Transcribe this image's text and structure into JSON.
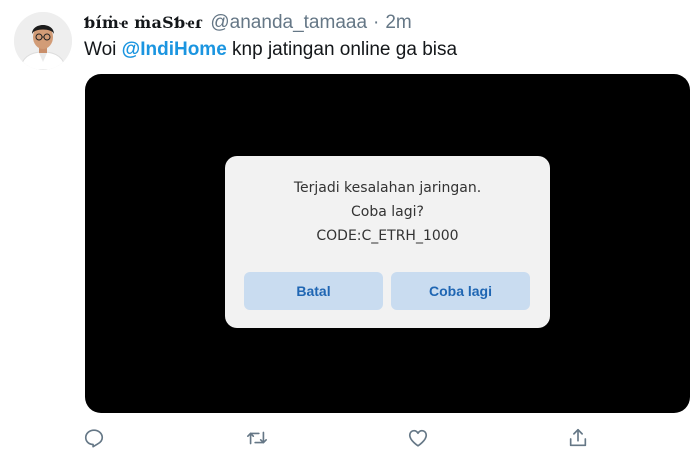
{
  "tweet": {
    "display_name": "ƅíṁҽ ṁaSƅҽɾ",
    "handle": "@ananda_tamaaa",
    "separator": "·",
    "time": "2m",
    "text_before": "Woi ",
    "mention": "@IndiHome",
    "text_after": " knp jatingan online ga bisa"
  },
  "media": {
    "dialog": {
      "line1": "Terjadi kesalahan jaringan.",
      "line2": "Coba lagi?",
      "line3": "CODE:C_ETRH_1000",
      "cancel_label": "Batal",
      "retry_label": "Coba lagi"
    }
  },
  "actions": {
    "icons": [
      "reply-icon",
      "retweet-icon",
      "like-icon",
      "share-icon"
    ]
  },
  "colors": {
    "mention": "#1b95e0",
    "muted": "#657786",
    "dialog_button_bg": "#c9dcf0",
    "dialog_button_text": "#1f66b3"
  }
}
